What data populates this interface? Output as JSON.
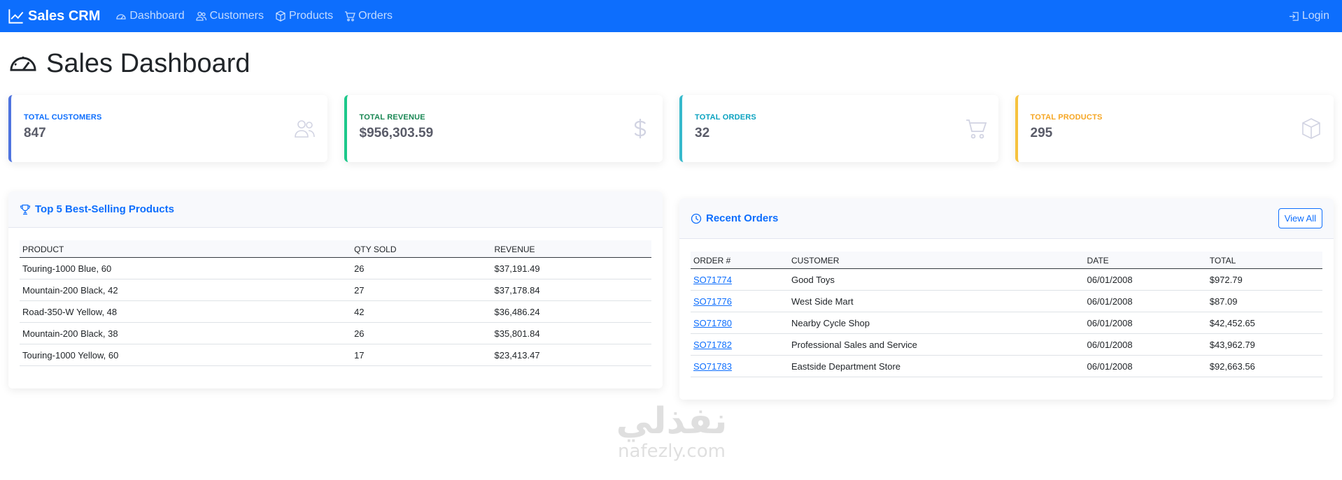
{
  "nav": {
    "brand": "Sales CRM",
    "links": [
      {
        "label": "Dashboard",
        "icon": "speedometer-icon"
      },
      {
        "label": "Customers",
        "icon": "people-icon"
      },
      {
        "label": "Products",
        "icon": "box-icon"
      },
      {
        "label": "Orders",
        "icon": "cart-icon"
      }
    ],
    "login": "Login"
  },
  "page": {
    "title": "Sales Dashboard"
  },
  "stats": [
    {
      "label": "TOTAL CUSTOMERS",
      "value": "847",
      "icon": "people-icon",
      "color": "#4e73df"
    },
    {
      "label": "TOTAL REVENUE",
      "value": "$956,303.59",
      "icon": "dollar-icon",
      "color": "#1cc88a"
    },
    {
      "label": "TOTAL ORDERS",
      "value": "32",
      "icon": "cart-icon",
      "color": "#36b9cc"
    },
    {
      "label": "TOTAL PRODUCTS",
      "value": "295",
      "icon": "box-icon",
      "color": "#f6c23e"
    }
  ],
  "top_products": {
    "title": "Top 5 Best-Selling Products",
    "columns": [
      "PRODUCT",
      "QTY SOLD",
      "REVENUE"
    ],
    "rows": [
      [
        "Touring-1000 Blue, 60",
        "26",
        "$37,191.49"
      ],
      [
        "Mountain-200 Black, 42",
        "27",
        "$37,178.84"
      ],
      [
        "Road-350-W Yellow, 48",
        "42",
        "$36,486.24"
      ],
      [
        "Mountain-200 Black, 38",
        "26",
        "$35,801.84"
      ],
      [
        "Touring-1000 Yellow, 60",
        "17",
        "$23,413.47"
      ]
    ]
  },
  "recent_orders": {
    "title": "Recent Orders",
    "view_all": "View All",
    "columns": [
      "ORDER #",
      "CUSTOMER",
      "DATE",
      "TOTAL"
    ],
    "rows": [
      [
        "SO71774",
        "Good Toys",
        "06/01/2008",
        "$972.79"
      ],
      [
        "SO71776",
        "West Side Mart",
        "06/01/2008",
        "$87.09"
      ],
      [
        "SO71780",
        "Nearby Cycle Shop",
        "06/01/2008",
        "$42,452.65"
      ],
      [
        "SO71782",
        "Professional Sales and Service",
        "06/01/2008",
        "$43,962.79"
      ],
      [
        "SO71783",
        "Eastside Department Store",
        "06/01/2008",
        "$92,663.56"
      ]
    ]
  },
  "watermark": {
    "script": "نفذلي",
    "latin": "nafezly.com"
  }
}
